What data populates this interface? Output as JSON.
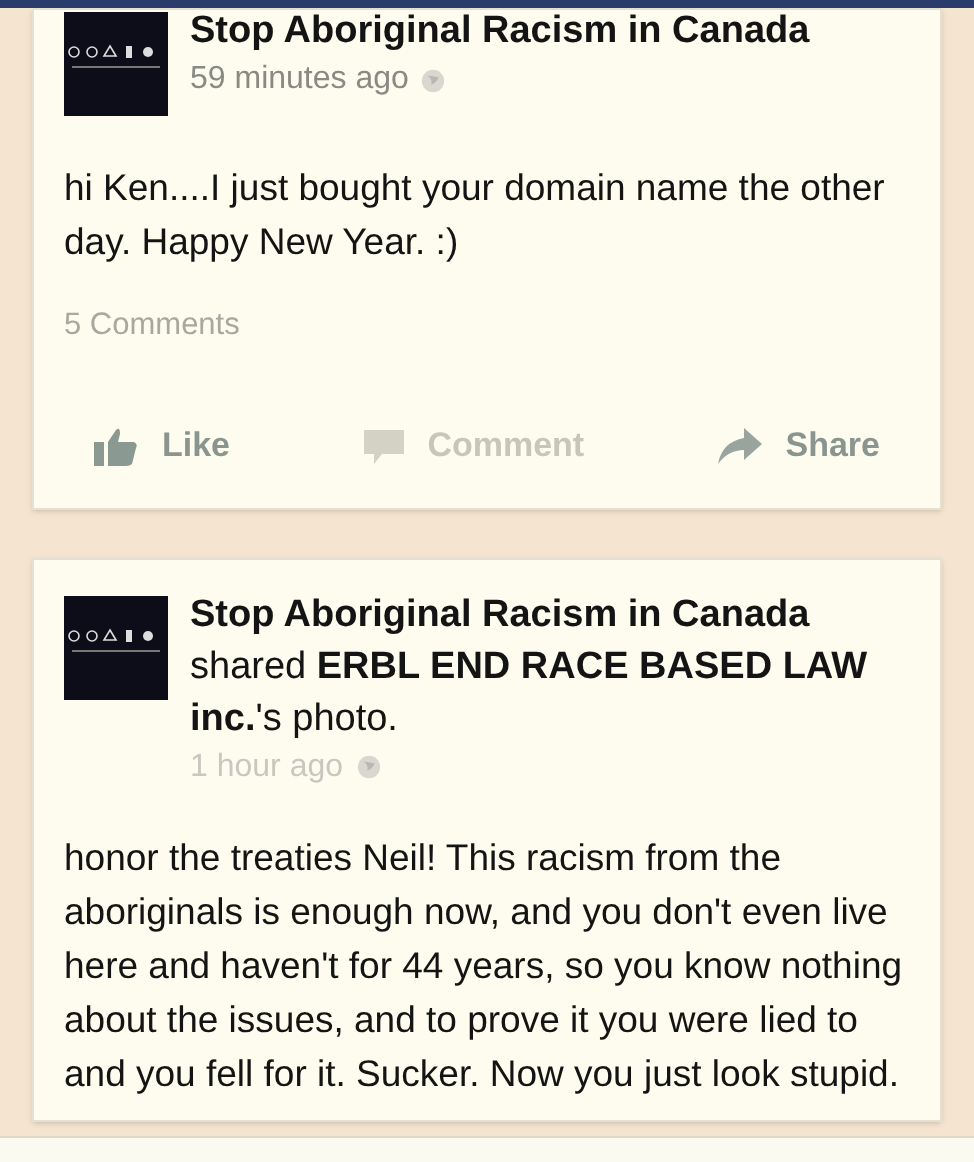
{
  "posts": [
    {
      "author": "Stop Aboriginal Racism in Canada",
      "time": "59 minutes ago",
      "text": "hi Ken....I just bought your domain name the other day. Happy New Year. :)",
      "comments": "5 Comments",
      "actions": [
        {
          "kind": "like",
          "label": "Like"
        },
        {
          "kind": "comment",
          "label": "Comment"
        },
        {
          "kind": "share",
          "label": "Share"
        }
      ]
    },
    {
      "author": "Stop Aboriginal Racism in Canada",
      "shared_line": "shared **ERBL END RACE BASED LAW inc.**'s photo.",
      "time": "1 hour ago",
      "text": "honor the treaties Neil! This racism from the aboriginals is enough now, and you don't even live here and haven't for 44 years, so you know nothing about the issues, and to prove it you were lied to and you fell for it. Sucker. Now you just look stupid."
    }
  ]
}
